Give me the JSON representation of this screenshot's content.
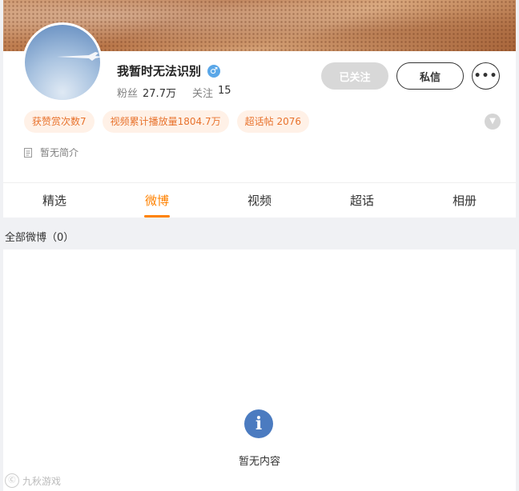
{
  "profile": {
    "name": "我暂时无法识别",
    "gender_symbol": "♂",
    "stats": {
      "fans_label": "粉丝",
      "fans_value": "27.7万",
      "following_label": "关注",
      "following_value": "15"
    },
    "buttons": {
      "followed": "已关注",
      "message": "私信",
      "more": "•••"
    },
    "tags": [
      "获赞赏次数7",
      "视频累计播放量1804.7万",
      "超话帖 2076"
    ],
    "intro": "暂无简介"
  },
  "tabs": [
    {
      "label": "精选",
      "active": false
    },
    {
      "label": "微博",
      "active": true
    },
    {
      "label": "视频",
      "active": false
    },
    {
      "label": "超话",
      "active": false
    },
    {
      "label": "相册",
      "active": false
    }
  ],
  "feed": {
    "section_title": "全部微博（0）",
    "empty_icon": "i",
    "empty_text": "暂无内容"
  },
  "watermark": {
    "icon": "Ⓒ",
    "text": "九秋游戏"
  },
  "colors": {
    "accent": "#ff8200",
    "tag_text": "#e8722c",
    "tag_bg": "#fff1e7",
    "info_icon": "#4b7bc0"
  }
}
